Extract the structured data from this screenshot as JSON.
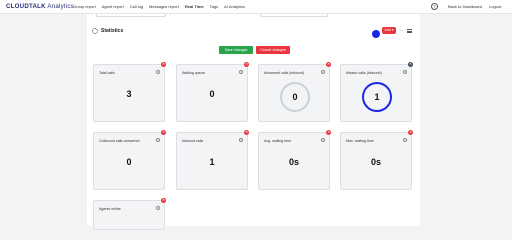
{
  "header": {
    "logo_brand": "CLOUDTALK",
    "logo_sub": "Analytics",
    "nav": [
      {
        "label": "Group report",
        "active": false
      },
      {
        "label": "Agent report",
        "active": false
      },
      {
        "label": "Call log",
        "active": false
      },
      {
        "label": "Messages report",
        "active": false
      },
      {
        "label": "Real Time",
        "active": true
      },
      {
        "label": "Tags",
        "active": false
      },
      {
        "label": "AI Analytics",
        "active": false
      }
    ],
    "help_glyph": "?",
    "back_label": "Back to Dashboard",
    "logout_label": "Logout"
  },
  "statistics": {
    "title": "Statistics",
    "add_label": "Add",
    "dots_glyph": "···",
    "save_label": "Save changes",
    "cancel_label": "Cancel changes"
  },
  "cards": [
    {
      "title": "Total calls",
      "value": "3",
      "style": "plain",
      "remove_icon": "red"
    },
    {
      "title": "Waiting queue",
      "value": "0",
      "style": "plain",
      "remove_icon": "red"
    },
    {
      "title": "Answered calls (inbound)",
      "value": "0",
      "style": "ring-grey",
      "remove_icon": "red"
    },
    {
      "title": "Missed calls (inbound)",
      "value": "1",
      "style": "ring-blue",
      "remove_icon": "dark"
    },
    {
      "title": "Outbound calls answered",
      "value": "0",
      "style": "plain",
      "remove_icon": "red"
    },
    {
      "title": "Inbound calls",
      "value": "1",
      "style": "plain",
      "remove_icon": "red"
    },
    {
      "title": "Avg. waiting time",
      "value": "0s",
      "style": "plain",
      "remove_icon": "red"
    },
    {
      "title": "Max. waiting time",
      "value": "0s",
      "style": "plain",
      "remove_icon": "red"
    },
    {
      "title": "Agents online",
      "value": "",
      "style": "plain",
      "remove_icon": "red"
    }
  ],
  "colors": {
    "accent_blue": "#1a26e8",
    "danger_red": "#e8353f",
    "success_green": "#28a44a",
    "brand_navy": "#2b2f7a"
  },
  "icons": {
    "remove": "close-icon",
    "info": "info-icon",
    "settings": "gear-icon",
    "help": "help-icon"
  }
}
